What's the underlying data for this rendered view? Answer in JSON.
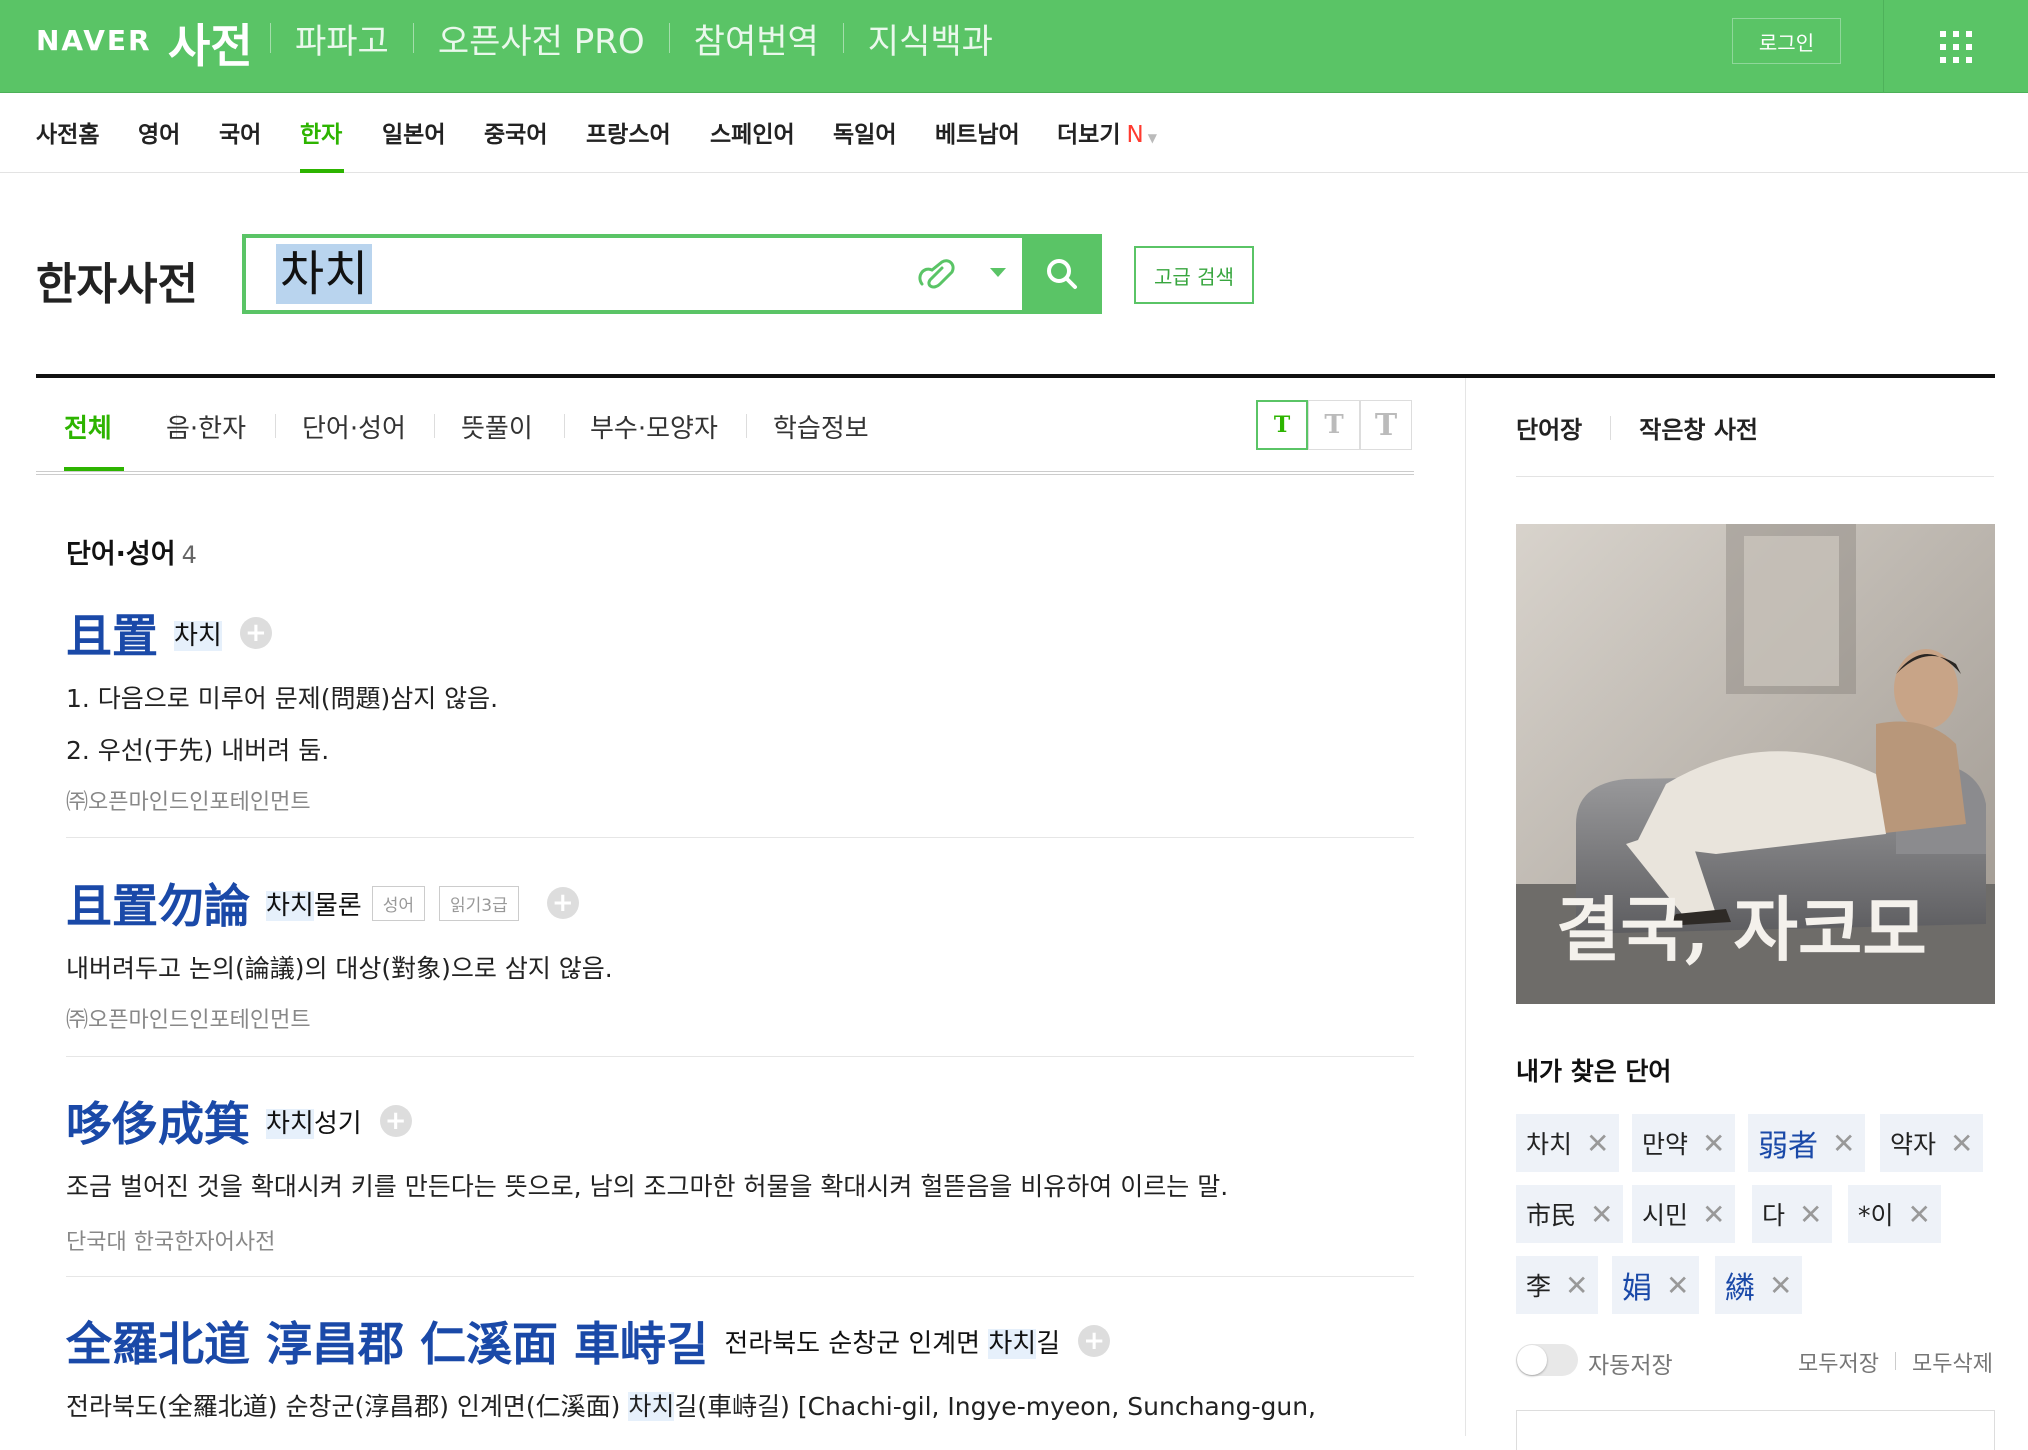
{
  "brand": {
    "naver": "NAVER",
    "service": "사전"
  },
  "top_nav": [
    "파파고",
    "오픈사전 PRO",
    "참여번역",
    "지식백과"
  ],
  "login_label": "로그인",
  "lang_nav": {
    "items": [
      "사전홈",
      "영어",
      "국어",
      "한자",
      "일본어",
      "중국어",
      "프랑스어",
      "스페인어",
      "독일어",
      "베트남어",
      "더보기"
    ],
    "active": "한자",
    "new_badge": "N"
  },
  "search": {
    "section_title": "한자사전",
    "query": "차치",
    "advanced_label": "고급 검색"
  },
  "tabs": {
    "items": [
      "전체",
      "음·한자",
      "단어·성어",
      "뜻풀이",
      "부수·모양자",
      "학습정보"
    ],
    "active": "전체",
    "font_sizes": [
      "T",
      "T",
      "T"
    ]
  },
  "results": {
    "heading": "단어·성어",
    "count": "4",
    "entries": [
      {
        "hanja": "且置",
        "reading_hl": "차치",
        "reading_rest": "",
        "tags": [],
        "defs": [
          "1. 다음으로 미루어 문제(問題)삼지 않음.",
          "2. 우선(于先) 내버려 둠."
        ],
        "source": "㈜오픈마인드인포테인먼트"
      },
      {
        "hanja": "且置勿論",
        "reading_hl": "차치",
        "reading_rest": "물론",
        "tags": [
          "성어",
          "읽기3급"
        ],
        "defs": [
          "내버려두고 논의(論議)의 대상(對象)으로 삼지 않음."
        ],
        "source": "㈜오픈마인드인포테인먼트"
      },
      {
        "hanja": "哆侈成箕",
        "reading_hl": "차치",
        "reading_rest": "성기",
        "tags": [],
        "defs": [
          "조금 벌어진 것을 확대시켜 키를 만든다는 뜻으로, 남의 조그마한 허물을 확대시켜 헐뜯음을 비유하여 이르는 말."
        ],
        "source": "단국대 한국한자어사전"
      },
      {
        "hanja": "全羅北道 淳昌郡 仁溪面 車峙길",
        "reading_pre": "전라북도 순창군 인계면 ",
        "reading_hl": "차치",
        "reading_rest": "길",
        "def_pre": "전라북도(全羅北道) 순창군(淳昌郡) 인계면(仁溪面) ",
        "def_hl": "차치",
        "def_rest": "길(車峙길) [Chachi-gil, Ingye-myeon, Sunchang-gun,"
      }
    ]
  },
  "sidebar": {
    "tabs": [
      "단어장",
      "작은창 사전"
    ],
    "ad_text": "결국, 자코모",
    "my_words_title": "내가 찾은 단어",
    "chips": [
      "차치",
      "만약",
      "弱者",
      "약자",
      "市民",
      "시민",
      "다",
      "*이",
      "李",
      "娟",
      "繗"
    ],
    "auto_save": "자동저장",
    "save_all": "모두저장",
    "delete_all": "모두삭제"
  },
  "colors": {
    "brand_green": "#5ac466",
    "active_green": "#2db400",
    "hanja_blue": "#1a49a8"
  }
}
